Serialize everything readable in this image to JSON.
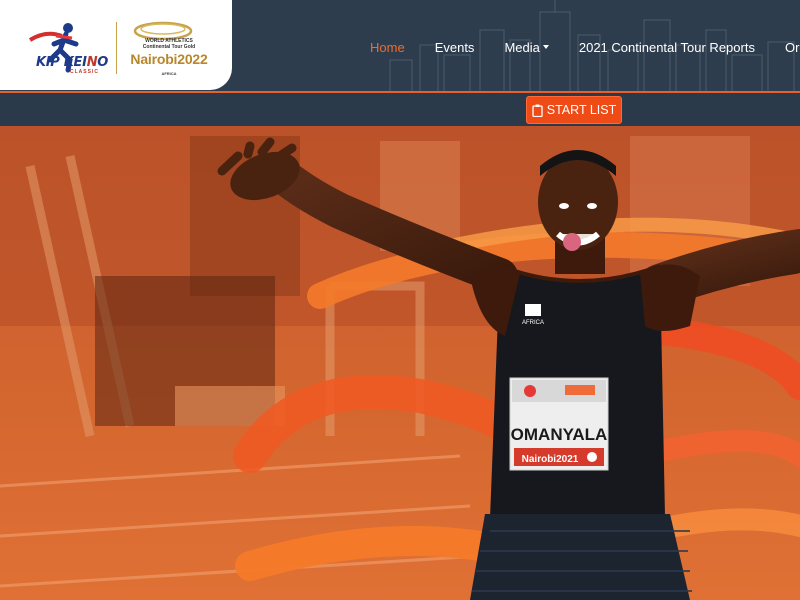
{
  "logos": {
    "kip_keino": {
      "part1": "KIP",
      "part2": "KEI",
      "accent": "N",
      "part3": "O",
      "subtitle": "CLASSIC"
    },
    "event": {
      "line1": "WORLD ATHLETICS",
      "line2": "Continental Tour Gold",
      "title": "Nairobi2022",
      "region": "AFRICA"
    }
  },
  "nav": {
    "items": [
      {
        "label": "Home",
        "active": true
      },
      {
        "label": "Events",
        "active": false
      },
      {
        "label": "Media",
        "active": false,
        "dropdown": true
      },
      {
        "label": "2021 Continental Tour Reports",
        "active": false
      },
      {
        "label": "Orga",
        "active": false
      }
    ]
  },
  "start_list_button": {
    "label": "START LIST",
    "icon": "clipboard-icon"
  },
  "hero": {
    "bib_name": "OMANYALA",
    "bib_event": "Nairobi2021",
    "vest_brand": "AFRICA"
  },
  "colors": {
    "header_bg": "#2e3d4d",
    "accent_orange": "#f26a2e",
    "button": "#ee4b16",
    "gold": "#b8862b"
  }
}
